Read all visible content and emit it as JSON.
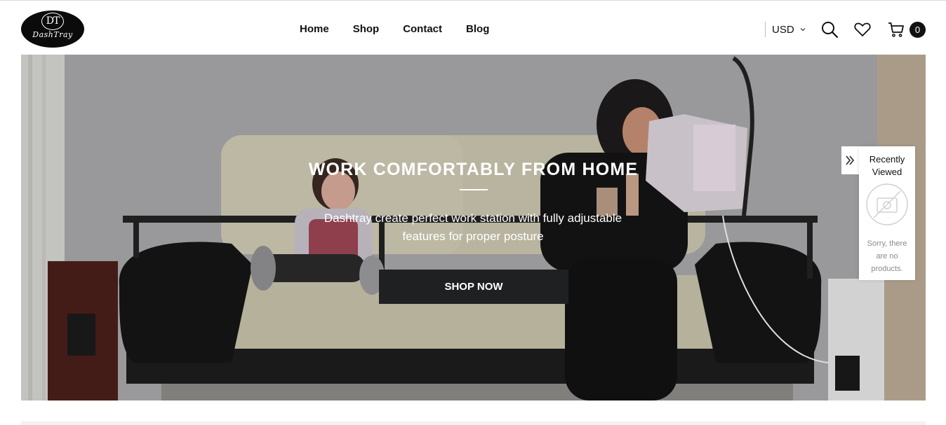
{
  "header": {
    "logo": {
      "monogram": "DT",
      "wordmark": "DashTray"
    },
    "nav": [
      {
        "label": "Home"
      },
      {
        "label": "Shop"
      },
      {
        "label": "Contact"
      },
      {
        "label": "Blog"
      }
    ],
    "currency": "USD",
    "icons": {
      "search": "search-icon",
      "wishlist": "heart-icon",
      "cart": "cart-icon",
      "currency_caret": "chevron-down-icon"
    },
    "cart_count": "0"
  },
  "hero": {
    "title": "WORK COMFORTABLY FROM HOME",
    "subtitle": "Dashtray create perfect work station with fully adjustable features for proper posture",
    "button_label": "SHOP NOW"
  },
  "recently_viewed": {
    "title": "Recently Viewed",
    "empty_message": "Sorry, there are no products.",
    "toggle_icon": "double-chevron-right-icon"
  },
  "colors": {
    "accent": "#111111",
    "button_bg": "#1e2022",
    "hero_overlay": "#a5a6a8"
  }
}
